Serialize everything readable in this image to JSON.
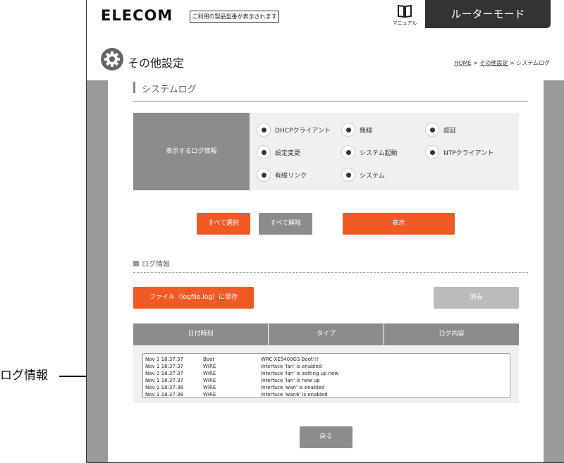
{
  "callout": {
    "label": "ログ情報"
  },
  "header": {
    "logo": "ELECOM",
    "model_notice": "ご利用の製品型番が表示されます",
    "manual_label": "マニュアル",
    "mode_tab": "ルーターモード"
  },
  "page": {
    "title": "その他設定",
    "breadcrumb": {
      "home": "HOME",
      "sep1": " > ",
      "parent": "その他設定",
      "sep2": " > ",
      "current": "システムログ"
    },
    "section_title": "システムログ"
  },
  "filter": {
    "label": "表示するログ情報",
    "options": [
      {
        "label": "DHCPクライアント"
      },
      {
        "label": "無線"
      },
      {
        "label": "認証"
      },
      {
        "label": "設定変更"
      },
      {
        "label": "システム起動"
      },
      {
        "label": "NTPクライアント"
      },
      {
        "label": "有線リンク"
      },
      {
        "label": "システム"
      }
    ]
  },
  "buttons": {
    "select_all": "すべて選択",
    "deselect_all": "すべて解除",
    "show": "表示",
    "save_file": "ファイル（logfile.log）に保存",
    "clear": "消去",
    "back": "戻る"
  },
  "log_section": {
    "title": "ログ情報",
    "columns": [
      "日付時刻",
      "タイプ",
      "ログ内容"
    ],
    "rows": [
      {
        "time": "Nov  1 18:37:37",
        "type": "Boot",
        "content": "WRC-XE5400GS Boot!!!"
      },
      {
        "time": "Nov  1 18:37:37",
        "type": "WIRE",
        "content": "Interface 'lan' is enabled"
      },
      {
        "time": "Nov  1 18:37:37",
        "type": "WIRE",
        "content": "Interface 'lan' is setting up now"
      },
      {
        "time": "Nov  1 18:37:37",
        "type": "WIRE",
        "content": "Interface 'lan' is now up"
      },
      {
        "time": "Nov  1 18:37:38",
        "type": "WIRE",
        "content": "Interface 'wan' is enabled"
      },
      {
        "time": "Nov  1 18:37:38",
        "type": "WIRE",
        "content": "Interface 'wan6' is enabled"
      }
    ]
  },
  "icons": {
    "manual": "book-icon",
    "settings": "gear-icon",
    "radio": "radio-selected-icon"
  },
  "colors": {
    "accent": "#f15a24",
    "gray_button": "#8c8c8c",
    "disabled_button": "#bbbbbb",
    "header_tab": "#333333"
  }
}
